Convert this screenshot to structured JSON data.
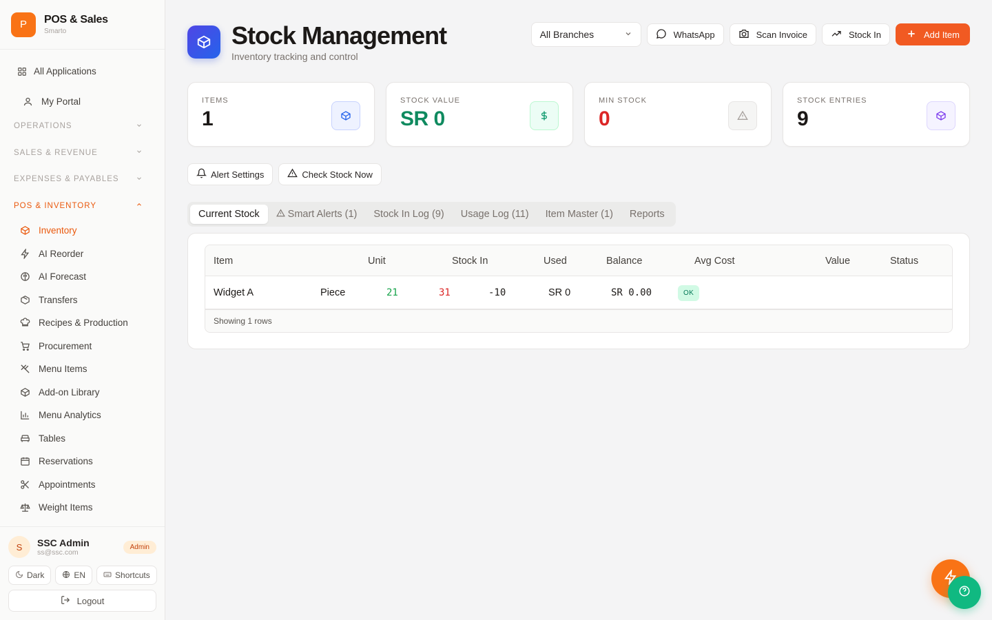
{
  "brand": {
    "logo_letter": "P",
    "name": "POS & Sales",
    "sub": "Smarto"
  },
  "nav": {
    "all_apps": "All Applications",
    "my_portal": "My Portal",
    "sections": [
      "OPERATIONS",
      "SALES & REVENUE",
      "EXPENSES & PAYABLES",
      "POS & INVENTORY"
    ],
    "items": [
      "Inventory",
      "AI Reorder",
      "AI Forecast",
      "Transfers",
      "Recipes & Production",
      "Procurement",
      "Menu Items",
      "Add-on Library",
      "Menu Analytics",
      "Tables",
      "Reservations",
      "Appointments",
      "Weight Items"
    ]
  },
  "user": {
    "initial": "S",
    "name": "SSC Admin",
    "email": "ss@ssc.com",
    "role": "Admin"
  },
  "footer": {
    "dark": "Dark",
    "lang": "EN",
    "shortcuts": "Shortcuts",
    "logout": "Logout"
  },
  "header": {
    "title": "Stock Management",
    "subtitle": "Inventory tracking and control"
  },
  "actions": {
    "branch": "All Branches",
    "whatsapp": "WhatsApp",
    "scan": "Scan Invoice",
    "stock_in": "Stock In",
    "add_item": "Add Item"
  },
  "stats": [
    {
      "label": "ITEMS",
      "value": "1",
      "color": "#1c1917"
    },
    {
      "label": "STOCK VALUE",
      "value": "SR 0",
      "color": "#0f8a5f"
    },
    {
      "label": "MIN STOCK",
      "value": "0",
      "color": "#dc2626"
    },
    {
      "label": "STOCK ENTRIES",
      "value": "9",
      "color": "#1c1917"
    }
  ],
  "tools": {
    "alert_settings": "Alert Settings",
    "check_stock": "Check Stock Now"
  },
  "tabs": [
    "Current Stock",
    "Smart Alerts (1)",
    "Stock In Log (9)",
    "Usage Log (11)",
    "Item Master (1)",
    "Reports"
  ],
  "table": {
    "headers": [
      "Item",
      "Unit",
      "Stock In",
      "Used",
      "Balance",
      "Avg Cost",
      "Value",
      "Status"
    ],
    "row": {
      "item": "Widget A",
      "unit": "Piece",
      "stock_in": "21",
      "used": "31",
      "balance": "-10",
      "avg_cost": "SR 0",
      "value": "SR 0.00",
      "status": "OK"
    },
    "footer": "Showing 1 rows"
  },
  "colors": {
    "accent": "#f97316",
    "primary_button": "#f15a22",
    "green": "#16a34a",
    "red": "#dc2626",
    "help": "#10b981"
  }
}
